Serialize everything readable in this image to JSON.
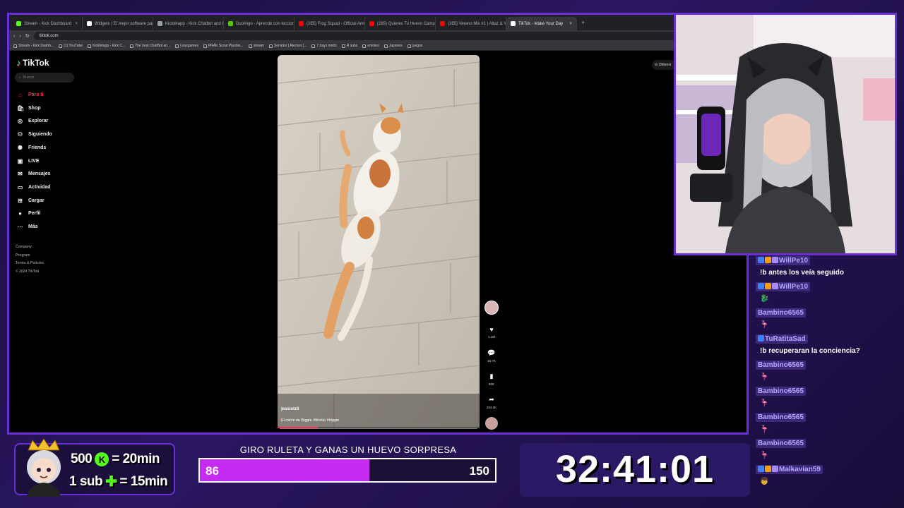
{
  "browser": {
    "tabs": [
      {
        "label": "Stream - Kick Dashboard",
        "color": "#53fc18"
      },
      {
        "label": "Widgets | El mejor software para po",
        "color": "#ffffff"
      },
      {
        "label": "Kickletapp - Kick Chatbot and Overl",
        "color": "#9aa0a6"
      },
      {
        "label": "Duolingo - Aprende con lecciones d",
        "color": "#58cc02"
      },
      {
        "label": "(285) Frog Squad - Official Announ",
        "color": "#ff0000"
      },
      {
        "label": "(285) Quieres Tu Huevo Campeonat",
        "color": "#ff0000"
      },
      {
        "label": "(285) Verano Mix #1 | Altaz & Yorgh",
        "color": "#ff0000"
      },
      {
        "label": "TikTok - Make Your Day",
        "color": "#ffffff"
      }
    ],
    "url": "tiktok.com",
    "bookmarks": [
      "Stream - Kick Dashb...",
      "(1) YouTube",
      "Kickletapp - Kick C...",
      "The best ChatBot an...",
      "Lessgames",
      "PRAK Scout Plushie...",
      "stream",
      "Servidor | Aternos |...",
      "7 days mods",
      "R subs",
      "emotes",
      "Japones",
      "juegos"
    ]
  },
  "tiktok": {
    "logo": "TikTok",
    "search_placeholder": "Buscar",
    "nav": [
      {
        "label": "Para ti",
        "icon": "home-icon",
        "glyph": "⌂",
        "active": true
      },
      {
        "label": "Shop",
        "icon": "shop-icon",
        "glyph": "🛍"
      },
      {
        "label": "Explorar",
        "icon": "compass-icon",
        "glyph": "◎"
      },
      {
        "label": "Siguiendo",
        "icon": "following-icon",
        "glyph": "⚇"
      },
      {
        "label": "Friends",
        "icon": "friends-icon",
        "glyph": "⚉"
      },
      {
        "label": "LIVE",
        "icon": "live-icon",
        "glyph": "▣"
      },
      {
        "label": "Mensajes",
        "icon": "messages-icon",
        "glyph": "✉"
      },
      {
        "label": "Actividad",
        "icon": "activity-icon",
        "glyph": "▭"
      },
      {
        "label": "Cargar",
        "icon": "upload-icon",
        "glyph": "⊞"
      },
      {
        "label": "Perfil",
        "icon": "profile-icon",
        "glyph": "●"
      },
      {
        "label": "Más",
        "icon": "more-icon",
        "glyph": "⋯"
      }
    ],
    "footer": [
      "Company",
      "Program",
      "Terms & Policies",
      "© 2024 TikTok"
    ],
    "get_app": "Obtener",
    "video": {
      "author": "jessiotz0",
      "caption": "El michi de Biggie  #fitobio #biggie",
      "progress": 0.2
    },
    "actions": {
      "likes": "1.1M",
      "comments": "10.7K",
      "saves": "92K",
      "shares": "234.2K"
    }
  },
  "chat": [
    {
      "user": "WillPe10",
      "message": "!b antes los veía seguido",
      "emote": ""
    },
    {
      "user": "WillPe10",
      "message": "",
      "emote": "🐉"
    },
    {
      "user": "Bambino6565",
      "message": "",
      "emote": "🦩"
    },
    {
      "user": "TuRatitaSad",
      "message": "!b recuperaran la conciencia?",
      "emote": ""
    },
    {
      "user": "Bambino6565",
      "message": "",
      "emote": "🦩"
    },
    {
      "user": "Bambino6565",
      "message": "",
      "emote": "🦩"
    },
    {
      "user": "Bambino6565",
      "message": "",
      "emote": "🦩"
    },
    {
      "user": "Bambino6565",
      "message": "",
      "emote": "🦩"
    },
    {
      "user": "Malkavian59",
      "message": "",
      "emote": "👦"
    }
  ],
  "promo": {
    "line1_amount": "500",
    "line1_icon": "K",
    "line1_value": "= 20min",
    "line2_amount": "1 sub",
    "line2_value": "= 15min"
  },
  "goal": {
    "title": "GIRO RULETA Y GANAS UN HUEVO SORPRESA",
    "current": "86",
    "target": "150",
    "fraction": 0.573
  },
  "timer": "32:41:01",
  "colors": {
    "accent": "#6a2fd6",
    "tiktok_red": "#fe2c55",
    "goal_fill": "#c52bf0",
    "kick_green": "#53fc18"
  }
}
